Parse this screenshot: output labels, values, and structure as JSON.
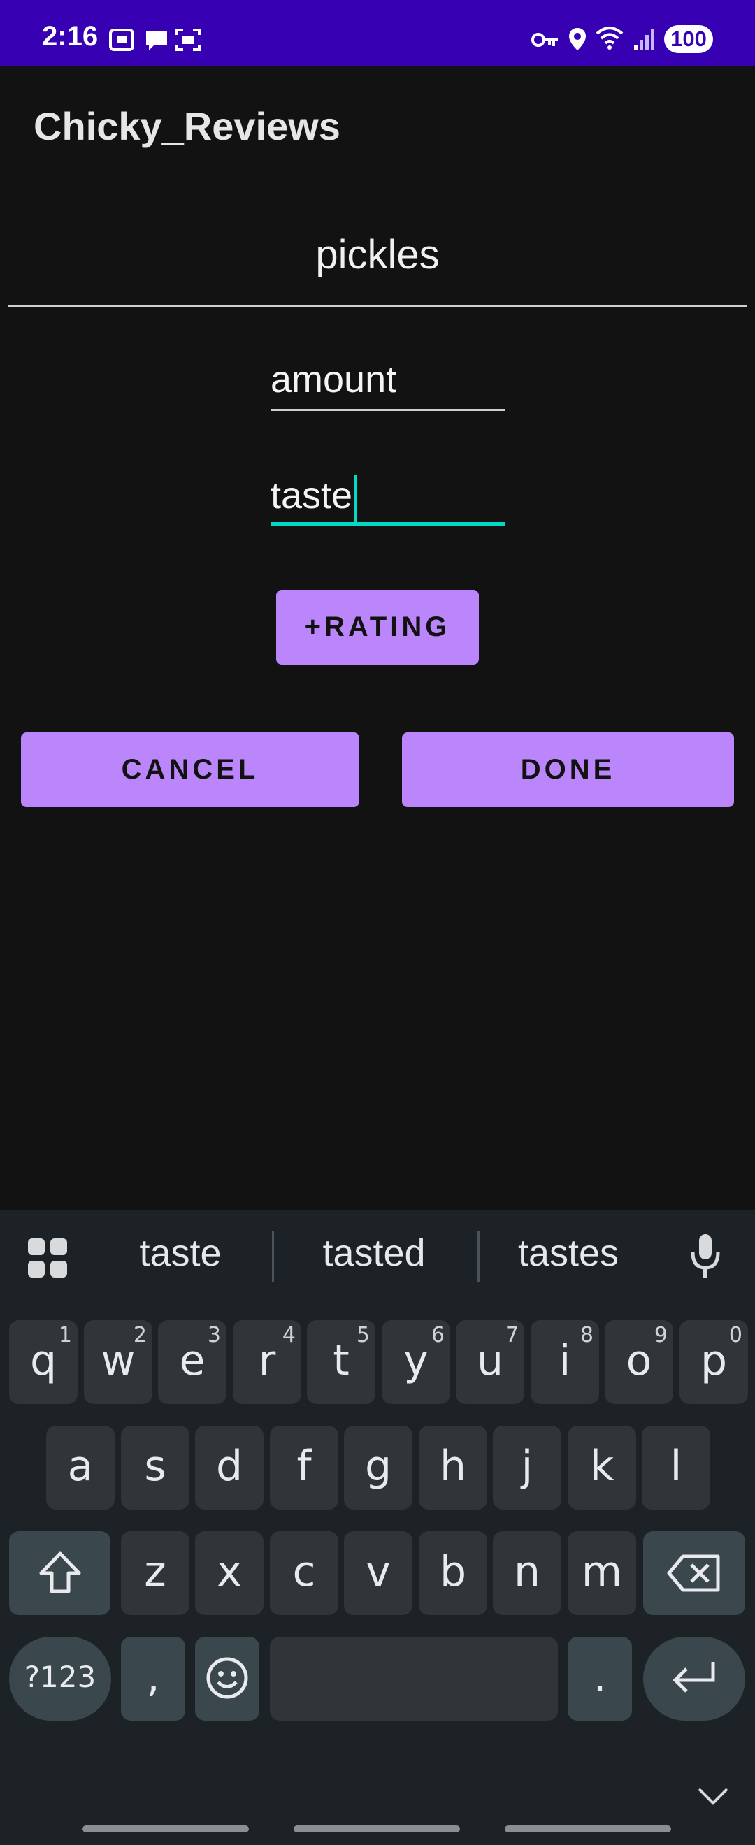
{
  "status_bar": {
    "time": "2:16",
    "battery": "100"
  },
  "app": {
    "title": "Chicky_Reviews"
  },
  "form": {
    "name_value": "pickles",
    "amount_placeholder": "amount",
    "taste_value": "taste"
  },
  "buttons": {
    "add_rating": "+RATING",
    "cancel": "CANCEL",
    "done": "DONE"
  },
  "keyboard": {
    "suggestions": [
      "taste",
      "tasted",
      "tastes"
    ],
    "row1": [
      {
        "k": "q",
        "n": "1"
      },
      {
        "k": "w",
        "n": "2"
      },
      {
        "k": "e",
        "n": "3"
      },
      {
        "k": "r",
        "n": "4"
      },
      {
        "k": "t",
        "n": "5"
      },
      {
        "k": "y",
        "n": "6"
      },
      {
        "k": "u",
        "n": "7"
      },
      {
        "k": "i",
        "n": "8"
      },
      {
        "k": "o",
        "n": "9"
      },
      {
        "k": "p",
        "n": "0"
      }
    ],
    "row2": [
      "a",
      "s",
      "d",
      "f",
      "g",
      "h",
      "j",
      "k",
      "l"
    ],
    "row3": [
      "z",
      "x",
      "c",
      "v",
      "b",
      "n",
      "m"
    ],
    "symbols_key": "?123",
    "comma_key": ",",
    "period_key": "."
  },
  "colors": {
    "accent": "#bb86fc",
    "status_bar": "#3700b3",
    "focus": "#03dac5"
  }
}
